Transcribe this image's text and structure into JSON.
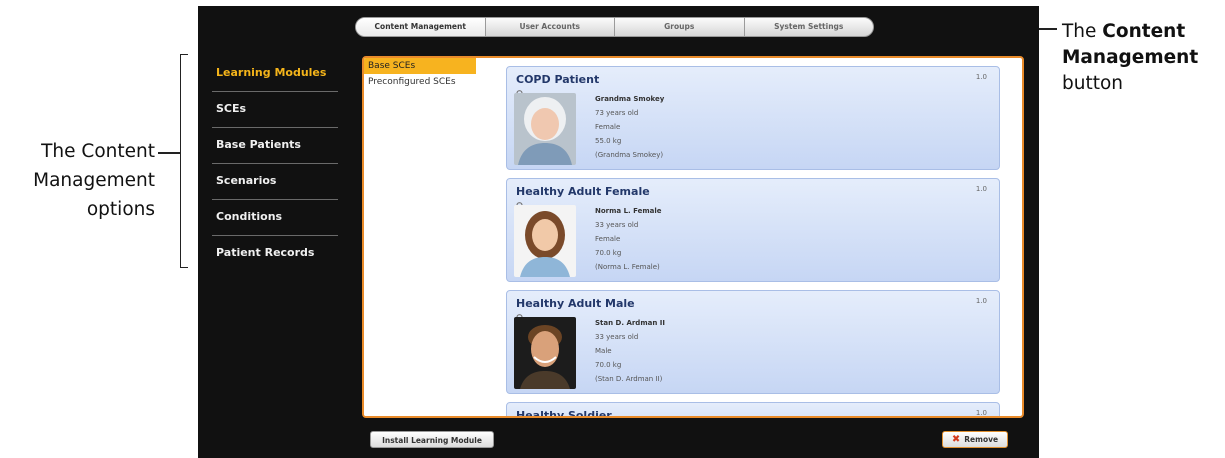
{
  "annotations": {
    "left": [
      "The Content",
      "Management",
      "options"
    ],
    "right": {
      "prefix": "The ",
      "bold1": "Content",
      "bold2": "Management",
      "suffix": "button"
    }
  },
  "tabs": [
    "Content Management",
    "User Accounts",
    "Groups",
    "System Settings"
  ],
  "sidebar": {
    "items": [
      "Learning Modules",
      "SCEs",
      "Base Patients",
      "Scenarios",
      "Conditions",
      "Patient Records"
    ]
  },
  "subnav": {
    "items": [
      "Base SCEs",
      "Preconfigured SCEs"
    ]
  },
  "cards": [
    {
      "title": "COPD Patient",
      "version": "1.0",
      "name": "Grandma Smokey",
      "age": "73 years old",
      "sex": "Female",
      "weight": "55.0 kg",
      "alias": "(Grandma Smokey)"
    },
    {
      "title": "Healthy Adult Female",
      "version": "1.0",
      "name": "Norma L. Female",
      "age": "33 years old",
      "sex": "Female",
      "weight": "70.0 kg",
      "alias": "(Norma L. Female)"
    },
    {
      "title": "Healthy Adult Male",
      "version": "1.0",
      "name": "Stan D. Ardman II",
      "age": "33 years old",
      "sex": "Male",
      "weight": "70.0 kg",
      "alias": "(Stan D. Ardman II)"
    },
    {
      "title": "Healthy Soldier",
      "version": "1.0"
    }
  ],
  "buttons": {
    "install": "Install Learning Module",
    "remove": "Remove"
  },
  "colors": {
    "accent": "#f4b41a",
    "frame": "#e98b2a",
    "card": "#c6d6f4",
    "remove_x": "#d43a1c"
  }
}
